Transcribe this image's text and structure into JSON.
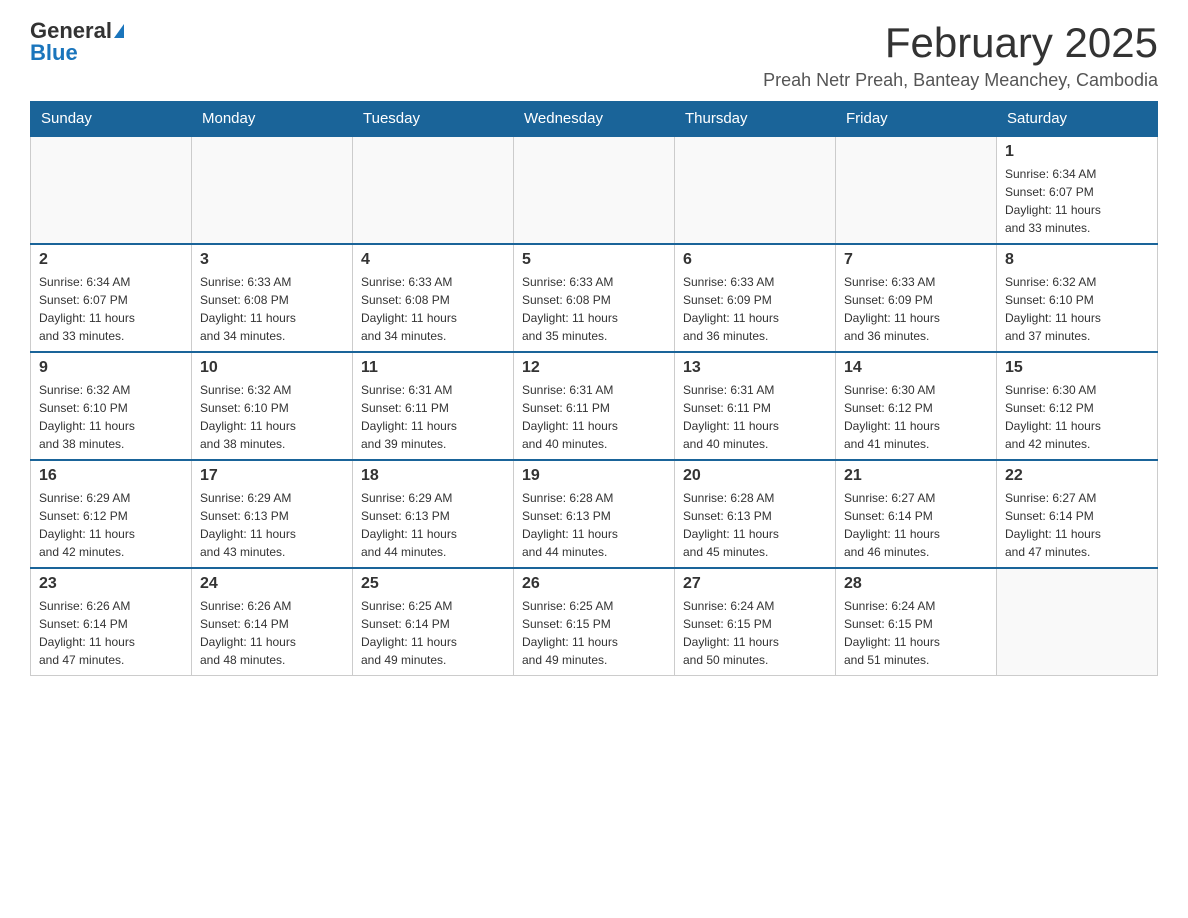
{
  "header": {
    "logo_general": "General",
    "logo_blue": "Blue",
    "month_title": "February 2025",
    "subtitle": "Preah Netr Preah, Banteay Meanchey, Cambodia"
  },
  "weekdays": [
    "Sunday",
    "Monday",
    "Tuesday",
    "Wednesday",
    "Thursday",
    "Friday",
    "Saturday"
  ],
  "weeks": [
    [
      {
        "day": "",
        "info": ""
      },
      {
        "day": "",
        "info": ""
      },
      {
        "day": "",
        "info": ""
      },
      {
        "day": "",
        "info": ""
      },
      {
        "day": "",
        "info": ""
      },
      {
        "day": "",
        "info": ""
      },
      {
        "day": "1",
        "info": "Sunrise: 6:34 AM\nSunset: 6:07 PM\nDaylight: 11 hours\nand 33 minutes."
      }
    ],
    [
      {
        "day": "2",
        "info": "Sunrise: 6:34 AM\nSunset: 6:07 PM\nDaylight: 11 hours\nand 33 minutes."
      },
      {
        "day": "3",
        "info": "Sunrise: 6:33 AM\nSunset: 6:08 PM\nDaylight: 11 hours\nand 34 minutes."
      },
      {
        "day": "4",
        "info": "Sunrise: 6:33 AM\nSunset: 6:08 PM\nDaylight: 11 hours\nand 34 minutes."
      },
      {
        "day": "5",
        "info": "Sunrise: 6:33 AM\nSunset: 6:08 PM\nDaylight: 11 hours\nand 35 minutes."
      },
      {
        "day": "6",
        "info": "Sunrise: 6:33 AM\nSunset: 6:09 PM\nDaylight: 11 hours\nand 36 minutes."
      },
      {
        "day": "7",
        "info": "Sunrise: 6:33 AM\nSunset: 6:09 PM\nDaylight: 11 hours\nand 36 minutes."
      },
      {
        "day": "8",
        "info": "Sunrise: 6:32 AM\nSunset: 6:10 PM\nDaylight: 11 hours\nand 37 minutes."
      }
    ],
    [
      {
        "day": "9",
        "info": "Sunrise: 6:32 AM\nSunset: 6:10 PM\nDaylight: 11 hours\nand 38 minutes."
      },
      {
        "day": "10",
        "info": "Sunrise: 6:32 AM\nSunset: 6:10 PM\nDaylight: 11 hours\nand 38 minutes."
      },
      {
        "day": "11",
        "info": "Sunrise: 6:31 AM\nSunset: 6:11 PM\nDaylight: 11 hours\nand 39 minutes."
      },
      {
        "day": "12",
        "info": "Sunrise: 6:31 AM\nSunset: 6:11 PM\nDaylight: 11 hours\nand 40 minutes."
      },
      {
        "day": "13",
        "info": "Sunrise: 6:31 AM\nSunset: 6:11 PM\nDaylight: 11 hours\nand 40 minutes."
      },
      {
        "day": "14",
        "info": "Sunrise: 6:30 AM\nSunset: 6:12 PM\nDaylight: 11 hours\nand 41 minutes."
      },
      {
        "day": "15",
        "info": "Sunrise: 6:30 AM\nSunset: 6:12 PM\nDaylight: 11 hours\nand 42 minutes."
      }
    ],
    [
      {
        "day": "16",
        "info": "Sunrise: 6:29 AM\nSunset: 6:12 PM\nDaylight: 11 hours\nand 42 minutes."
      },
      {
        "day": "17",
        "info": "Sunrise: 6:29 AM\nSunset: 6:13 PM\nDaylight: 11 hours\nand 43 minutes."
      },
      {
        "day": "18",
        "info": "Sunrise: 6:29 AM\nSunset: 6:13 PM\nDaylight: 11 hours\nand 44 minutes."
      },
      {
        "day": "19",
        "info": "Sunrise: 6:28 AM\nSunset: 6:13 PM\nDaylight: 11 hours\nand 44 minutes."
      },
      {
        "day": "20",
        "info": "Sunrise: 6:28 AM\nSunset: 6:13 PM\nDaylight: 11 hours\nand 45 minutes."
      },
      {
        "day": "21",
        "info": "Sunrise: 6:27 AM\nSunset: 6:14 PM\nDaylight: 11 hours\nand 46 minutes."
      },
      {
        "day": "22",
        "info": "Sunrise: 6:27 AM\nSunset: 6:14 PM\nDaylight: 11 hours\nand 47 minutes."
      }
    ],
    [
      {
        "day": "23",
        "info": "Sunrise: 6:26 AM\nSunset: 6:14 PM\nDaylight: 11 hours\nand 47 minutes."
      },
      {
        "day": "24",
        "info": "Sunrise: 6:26 AM\nSunset: 6:14 PM\nDaylight: 11 hours\nand 48 minutes."
      },
      {
        "day": "25",
        "info": "Sunrise: 6:25 AM\nSunset: 6:14 PM\nDaylight: 11 hours\nand 49 minutes."
      },
      {
        "day": "26",
        "info": "Sunrise: 6:25 AM\nSunset: 6:15 PM\nDaylight: 11 hours\nand 49 minutes."
      },
      {
        "day": "27",
        "info": "Sunrise: 6:24 AM\nSunset: 6:15 PM\nDaylight: 11 hours\nand 50 minutes."
      },
      {
        "day": "28",
        "info": "Sunrise: 6:24 AM\nSunset: 6:15 PM\nDaylight: 11 hours\nand 51 minutes."
      },
      {
        "day": "",
        "info": ""
      }
    ]
  ]
}
